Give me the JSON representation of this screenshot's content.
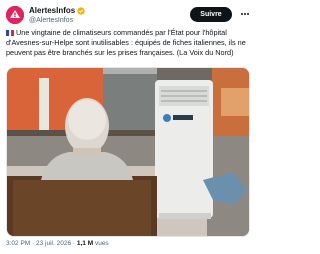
{
  "account": {
    "display_name": "AlertesInfos",
    "handle": "@AlertesInfos",
    "verified_badge_color": "#f5b301",
    "avatar_icon": "alert-logo-icon"
  },
  "actions": {
    "follow_label": "Suivre",
    "more_icon": "more-icon"
  },
  "tweet": {
    "flag_icon": "france-flag-icon",
    "text": "Une vingtaine de climatiseurs commandés par l'État pour l'hôpital d'Avesnes-sur-Helpe sont inutilisables : équipés de fiches italiennes, ils ne peuvent pas être branchés sur les prises françaises. (La Voix du Nord)"
  },
  "media": {
    "description_icon": "photo-elderly-person-air-conditioner"
  },
  "meta": {
    "time": "3:02 PM",
    "separator": "·",
    "date": "23 juil. 2026",
    "views_count": "1,1 M",
    "views_label": "vues"
  }
}
